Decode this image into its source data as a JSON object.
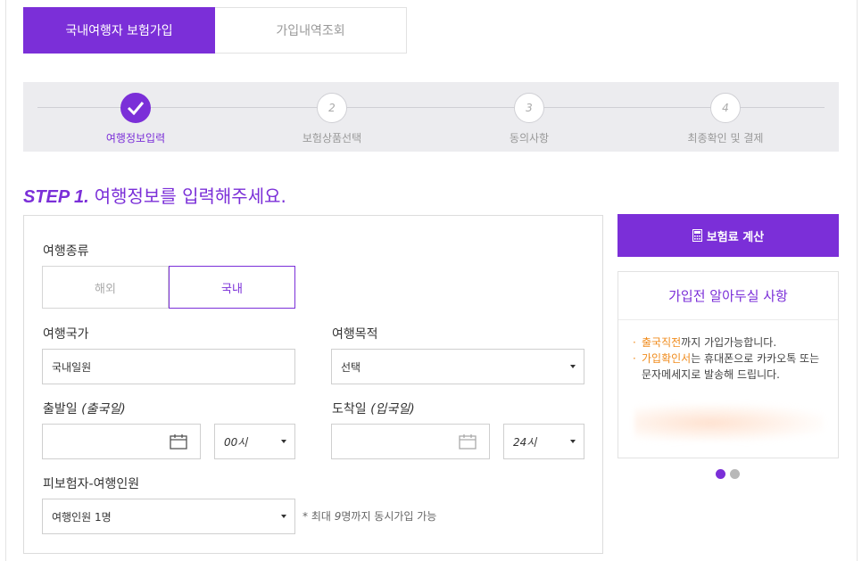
{
  "tabs": [
    {
      "label": "국내여행자 보험가입",
      "active": true
    },
    {
      "label": "가입내역조회",
      "active": false
    }
  ],
  "steps": [
    {
      "num": "",
      "label": "여행정보입력",
      "done": true
    },
    {
      "num": "2",
      "label": "보험상품선택",
      "done": false
    },
    {
      "num": "3",
      "label": "동의사항",
      "done": false
    },
    {
      "num": "4",
      "label": "최종확인 및 결제",
      "done": false
    }
  ],
  "heading": {
    "step": "STEP 1.",
    "text": "여행정보를 입력해주세요."
  },
  "form": {
    "trip_type": {
      "label": "여행종류",
      "options": [
        "해외",
        "국내"
      ],
      "selected": "국내"
    },
    "country": {
      "label": "여행국가",
      "value": "국내일원"
    },
    "purpose": {
      "label": "여행목적",
      "value": "선택"
    },
    "departure": {
      "label_main": "출발일",
      "label_sub": "(출국일)",
      "date": "",
      "hour": "00시"
    },
    "arrival": {
      "label_main": "도착일",
      "label_sub": "(입국일)",
      "date": "",
      "hour": "24시"
    },
    "travelers": {
      "label": "피보험자-여행인원",
      "value": "여행인원 1명",
      "note_prefix": "* 최대 ",
      "note_num": "9",
      "note_suffix": "명까지 동시가입 가능"
    }
  },
  "calc_button": {
    "label": "보험료 계산"
  },
  "notice": {
    "title": "가입전 알아두실 사항",
    "items": [
      {
        "highlight": "출국직전",
        "rest": "까지 가입가능합니다."
      },
      {
        "highlight": "가입확인서",
        "rest": "는 휴대폰으로 카카오톡 또는 문자메세지로 발송해 드립니다."
      }
    ]
  },
  "colors": {
    "accent": "#7b2fd8",
    "highlight": "#f08c1e",
    "stepbar_bg": "#ececef"
  }
}
